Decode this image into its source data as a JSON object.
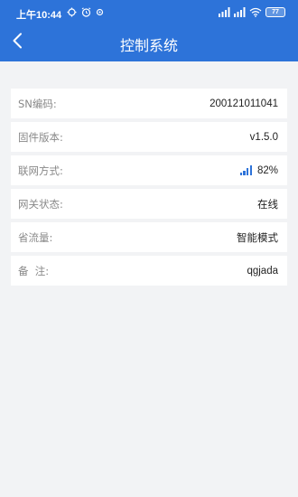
{
  "status_bar": {
    "time": "上午10:44",
    "battery": "77"
  },
  "header": {
    "title": "控制系统"
  },
  "fields": [
    {
      "label": "SN编码:",
      "value": "200121011041"
    },
    {
      "label": "固件版本:",
      "value": "v1.5.0"
    },
    {
      "label": "联网方式:",
      "value": "82%",
      "icon": "signal-icon"
    },
    {
      "label": "网关状态:",
      "value": "在线"
    },
    {
      "label": "省流量:",
      "value": "智能模式"
    },
    {
      "label": "备  注:",
      "value": "qgjada"
    }
  ],
  "colors": {
    "header_bg": "#2d73d9",
    "page_bg": "#f2f3f5",
    "signal": "#2d73d9"
  }
}
